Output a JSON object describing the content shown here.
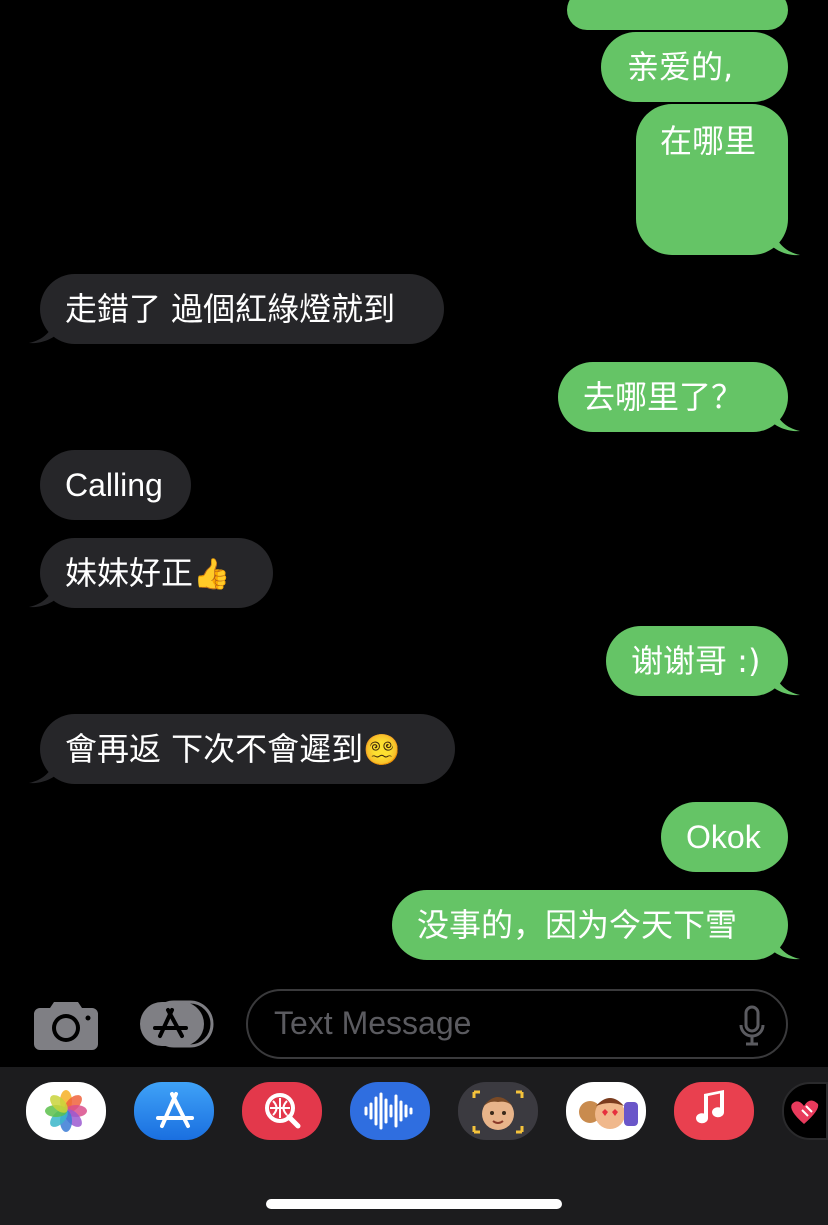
{
  "messages": [
    {
      "side": "out",
      "text": ""
    },
    {
      "side": "out",
      "text": "亲爱的,"
    },
    {
      "side": "out",
      "text": "在哪里"
    },
    {
      "side": "in",
      "text": "走錯了 過個紅綠燈就到"
    },
    {
      "side": "out",
      "text": "去哪里了？"
    },
    {
      "side": "in",
      "text": "Calling"
    },
    {
      "side": "in",
      "text": "妹妹好正",
      "emoji": "👍"
    },
    {
      "side": "out",
      "text": "谢谢哥 :)"
    },
    {
      "side": "in",
      "text": "會再返 下次不會遲到",
      "emoji": "😵‍💫"
    },
    {
      "side": "out",
      "text": "Okok"
    },
    {
      "side": "out",
      "text": "没事的，因为今天下雪"
    }
  ],
  "composer": {
    "placeholder": "Text Message"
  },
  "icons": {
    "camera": "camera-icon",
    "apps": "app-store-icon",
    "mic": "microphone-icon"
  },
  "app_drawer": [
    {
      "name": "Photos",
      "icon": "photos-icon"
    },
    {
      "name": "App Store",
      "icon": "app-store-icon"
    },
    {
      "name": "Search Images",
      "icon": "image-search-icon"
    },
    {
      "name": "Audio Message",
      "icon": "audio-waveform-icon"
    },
    {
      "name": "Memoji Stickers",
      "icon": "memoji-icon"
    },
    {
      "name": "Animoji",
      "icon": "animoji-icon"
    },
    {
      "name": "Music",
      "icon": "music-icon"
    },
    {
      "name": "Digital Touch",
      "icon": "digital-touch-icon"
    }
  ],
  "colors": {
    "outgoing_bubble": "#65c466",
    "incoming_bubble": "#262629",
    "background": "#000000"
  }
}
